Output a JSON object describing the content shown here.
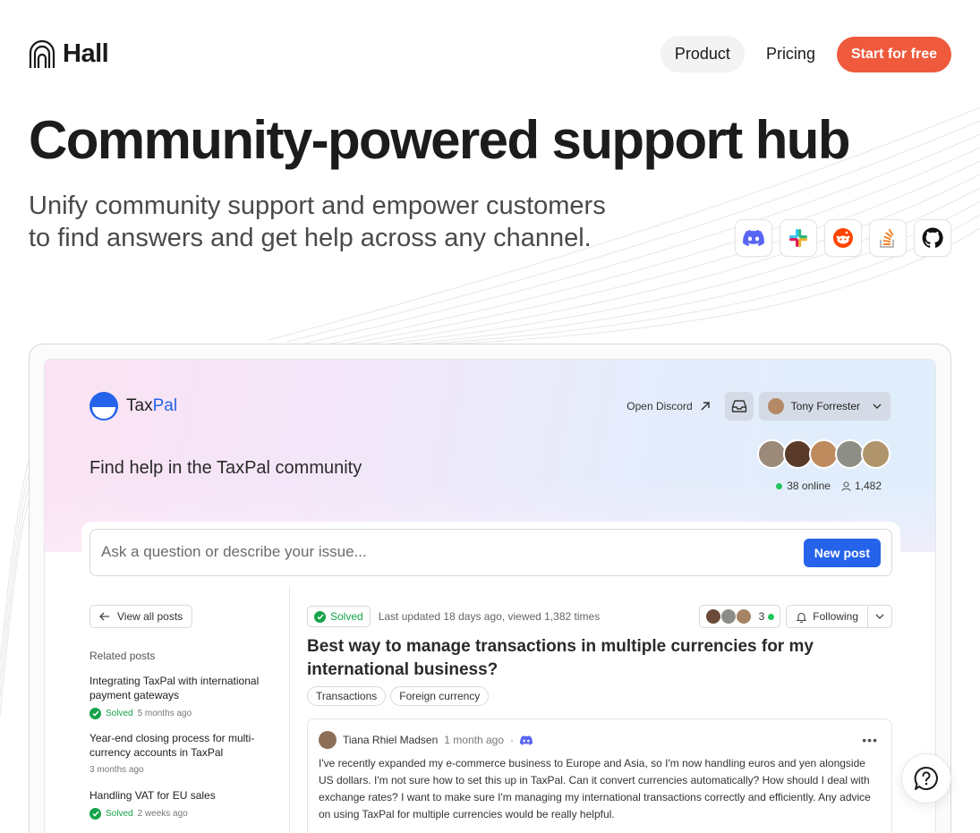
{
  "brand": {
    "name": "Hall"
  },
  "nav": {
    "product": "Product",
    "pricing": "Pricing",
    "cta": "Start for free"
  },
  "hero": {
    "title": "Community-powered support hub",
    "subtitle": "Unify community support and empower customers to find answers and get help across any channel."
  },
  "channels": [
    {
      "icon": "discord-icon"
    },
    {
      "icon": "slack-icon"
    },
    {
      "icon": "reddit-icon"
    },
    {
      "icon": "stackoverflow-icon"
    },
    {
      "icon": "github-icon"
    }
  ],
  "app": {
    "brand_first": "Tax",
    "brand_second": "Pal",
    "open_discord": "Open Discord",
    "user": "Tony Forrester",
    "heading": "Find help in the TaxPal community",
    "online": "38 online",
    "members": "1,482",
    "search_placeholder": "Ask a question or describe your issue...",
    "new_post": "New post",
    "view_all": "View all posts",
    "related_heading": "Related posts",
    "related": [
      {
        "title": "Integrating TaxPal with international payment gateways",
        "solved": "Solved",
        "time": "5 months ago"
      },
      {
        "title": "Year-end closing process for multi-currency accounts in TaxPal",
        "solved": "",
        "time": "3 months ago"
      },
      {
        "title": "Handling VAT for EU sales",
        "solved": "Solved",
        "time": "2 weeks ago"
      }
    ],
    "post": {
      "status": "Solved",
      "updated": "Last updated 18 days ago, viewed 1,382 times",
      "viewers_count": "3",
      "following": "Following",
      "title": "Best way to manage transactions in multiple currencies for my international business?",
      "tags": [
        "Transactions",
        "Foreign currency"
      ],
      "author": "Tiana Rhiel Madsen",
      "time": "1 month ago",
      "separator": "·",
      "body": "I've recently expanded my e-commerce business to Europe and Asia, so I'm now handling euros and yen alongside US dollars. I'm not sure how to set this up in TaxPal. Can it convert currencies automatically? How should I deal with exchange rates? I want to make sure I'm managing my international transactions correctly and efficiently. Any advice on using TaxPal for multiple currencies would be really helpful."
    }
  },
  "colors": {
    "accent": "#ef5a3c",
    "primary": "#2563eb",
    "success": "#16a34a"
  }
}
